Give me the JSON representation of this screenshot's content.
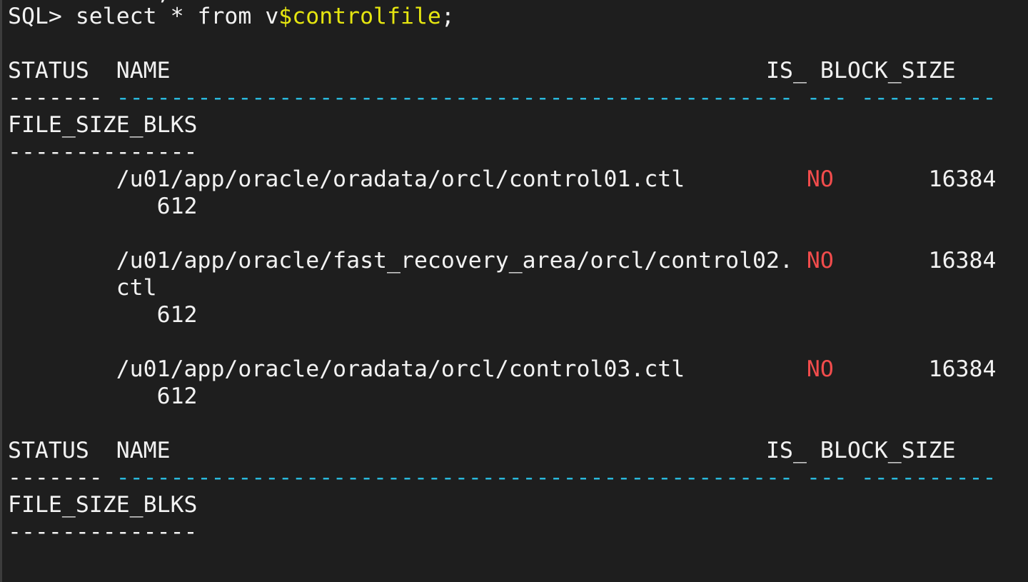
{
  "prompt": {
    "prefix": "SQL> select * from v",
    "highlight": "$controlfile",
    "suffix": ";"
  },
  "header1": {
    "status": "STATUS",
    "name": "NAME",
    "is": "IS_",
    "block_size": "BLOCK_SIZE",
    "file_size_blks": "FILE_SIZE_BLKS",
    "dash_status": "-------",
    "dash_name": "--------------------------------------------------",
    "dash_is": "---",
    "dash_block": "----------",
    "dash_file": "--------------"
  },
  "rows": [
    {
      "name": "/u01/app/oracle/oradata/orcl/control01.ctl",
      "name_cont": "",
      "is": "NO",
      "block_size": "16384",
      "file_size_blks": "612"
    },
    {
      "name": "/u01/app/oracle/fast_recovery_area/orcl/control02.",
      "name_cont": "ctl",
      "is": "NO",
      "block_size": "16384",
      "file_size_blks": "612"
    },
    {
      "name": "/u01/app/oracle/oradata/orcl/control03.ctl",
      "name_cont": "",
      "is": "NO",
      "block_size": "16384",
      "file_size_blks": "612"
    }
  ],
  "header2": {
    "status": "STATUS",
    "name": "NAME",
    "is": "IS_",
    "block_size": "BLOCK_SIZE",
    "file_size_blks": "FILE_SIZE_BLKS",
    "dash_status": "-------",
    "dash_name": "--------------------------------------------------",
    "dash_is": "---",
    "dash_block": "----------",
    "dash_file": "--------------"
  },
  "colors": {
    "background": "#1e1e1e",
    "text": "#f2f2f2",
    "highlight": "#e5e510",
    "value_no": "#f14c4c",
    "dash_accent": "#29b8db"
  }
}
